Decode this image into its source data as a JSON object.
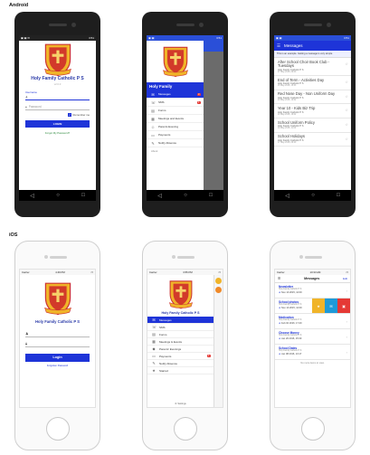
{
  "android": {
    "section_label": "Android",
    "status_time": "3:51",
    "login": {
      "school_name": "Holy Family Catholic P S",
      "version_label": "v2.0.0",
      "username_label": "Username",
      "password_placeholder": "Password",
      "remember_label": "Remember me",
      "login_button": "LOGIN",
      "forgot_link": "Forgot My Password?"
    },
    "drawer": {
      "header_title": "Holy Family",
      "items": [
        {
          "icon": "envelope-icon",
          "glyph": "✉",
          "label": "Messages",
          "badge": "3",
          "active": true
        },
        {
          "icon": "sms-icon",
          "glyph": "☏",
          "label": "SMS",
          "badge": "1"
        },
        {
          "icon": "forms-icon",
          "glyph": "▤",
          "label": "Forms",
          "badge": ""
        },
        {
          "icon": "calendar-icon",
          "glyph": "▦",
          "label": "Meetings and Events",
          "badge": ""
        },
        {
          "icon": "people-icon",
          "glyph": "☺",
          "label": "Parents Evening",
          "badge": ""
        },
        {
          "icon": "payment-icon",
          "glyph": "▭",
          "label": "Payments",
          "badge": ""
        },
        {
          "icon": "absence-icon",
          "glyph": "✎",
          "label": "Notify Absence",
          "badge": ""
        }
      ],
      "footer_label": "About"
    },
    "messages": {
      "title": "Messages",
      "banner": "This is an example. Getting a message is very simple",
      "items": [
        {
          "title": "After School Choir Book Club - Tuesdays",
          "sender": "Holy Family Catholic P S",
          "date": "27 May 2016, 09:00"
        },
        {
          "title": "End of Term - Activities Day",
          "sender": "Holy Family Catholic P S",
          "date": "25 May 2016, 15:33"
        },
        {
          "title": "Red Nose Day - Non Uniform Day",
          "sender": "Holy Family Catholic P S",
          "date": "24 May 2016, 10:02"
        },
        {
          "title": "Year 10 - Kids Biz Trip",
          "sender": "Holy Family Catholic P S",
          "date": "20 May 2016, 16:02"
        },
        {
          "title": "School Uniform Policy",
          "sender": "Holy Family Catholic P S",
          "date": "19 May 2016, 11:04"
        },
        {
          "title": "School Holidays",
          "sender": "Holy Family Catholic P S",
          "date": "17 May 2016, 09:20"
        }
      ]
    }
  },
  "ios": {
    "section_label": "iOS",
    "status": {
      "carrier": "Carrier",
      "time_login": "4:49 PM",
      "time_menu": "3:55 PM",
      "time_messages": "10:33 AM"
    },
    "login": {
      "school_name": "Holy Family Catholic P S",
      "login_button": "Login",
      "forgot_link": "Forgotten Password"
    },
    "menu": {
      "header_title": "Holy Family Catholic P S",
      "items": [
        {
          "icon": "envelope-icon",
          "glyph": "✉",
          "label": "Messages",
          "badge": "",
          "active": true
        },
        {
          "icon": "sms-icon",
          "glyph": "☏",
          "label": "SMS",
          "badge": ""
        },
        {
          "icon": "forms-icon",
          "glyph": "▤",
          "label": "Forms",
          "badge": ""
        },
        {
          "icon": "calendar-icon",
          "glyph": "▦",
          "label": "Meetings & Events",
          "badge": ""
        },
        {
          "icon": "tag-icon",
          "glyph": "◆",
          "label": "Parents' Evenings",
          "badge": ""
        },
        {
          "icon": "payment-icon",
          "glyph": "▭",
          "label": "Payments",
          "badge": "1"
        },
        {
          "icon": "absence-icon",
          "glyph": "✎",
          "label": "Notify Absence",
          "badge": ""
        },
        {
          "icon": "star-icon",
          "glyph": "★",
          "label": "Starred",
          "badge": ""
        }
      ],
      "settings_label": "Settings"
    },
    "messages": {
      "title": "Messages",
      "edit_label": "Edit",
      "items": [
        {
          "title": "Newsletter",
          "sender": "Holy Family Catholic P S",
          "meta": "Nov 13 2015, 12:00"
        },
        {
          "title": "School photos",
          "sender": "Holy Family Catholic P S",
          "meta": "Nov 13 2015, 12:00"
        },
        {
          "title": "Medication",
          "sender": "Holy Family Catholic P S",
          "meta": "Feb 02 2016, 17:40"
        },
        {
          "title": "Choose Money",
          "sender": "Holy Family Catholic P S",
          "meta": "Jan 20 2016, 15:30"
        },
        {
          "title": "School Dates",
          "sender": "Holy Family Catholic P S",
          "meta": "Jan 08 2016, 13:17"
        }
      ],
      "empty_text": "No more items to view."
    }
  },
  "colors": {
    "brand_blue": "#1e34d8",
    "crest_red": "#d23a2a",
    "crest_gold": "#f0b429",
    "badge_red": "#e53935"
  }
}
